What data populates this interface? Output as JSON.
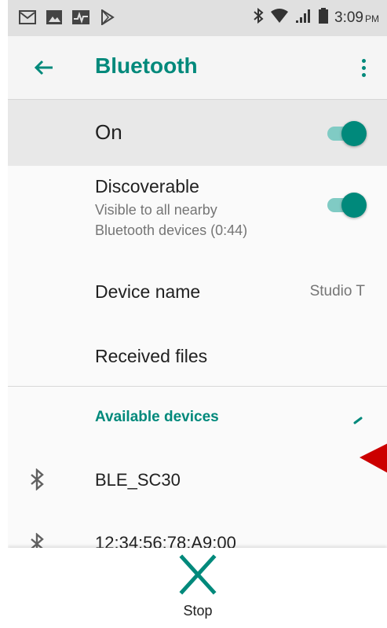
{
  "status_bar": {
    "time": "3:09",
    "ampm": "PM",
    "icons_left": [
      "gmail-icon",
      "image-icon",
      "activity-icon",
      "play-store-icon"
    ],
    "icons_right": [
      "bluetooth-icon",
      "wifi-icon",
      "signal-icon",
      "battery-icon"
    ]
  },
  "app_bar": {
    "title": "Bluetooth"
  },
  "master_switch": {
    "label": "On",
    "state": "on"
  },
  "discoverable": {
    "title": "Discoverable",
    "summary_line1": "Visible to all nearby",
    "summary_line2": "Bluetooth devices (0:44)",
    "state": "on"
  },
  "device_name": {
    "title": "Device name",
    "value": "Studio T"
  },
  "received_files": {
    "title": "Received files"
  },
  "available_devices": {
    "header": "Available devices",
    "devices": [
      {
        "name": "BLE_SC30"
      },
      {
        "name": "12:34:56:78:A9:00"
      }
    ]
  },
  "bottom": {
    "stop_label": "Stop"
  },
  "colors": {
    "accent": "#00897b",
    "accent_light": "#80cbc4",
    "pointer": "#cc0000"
  }
}
